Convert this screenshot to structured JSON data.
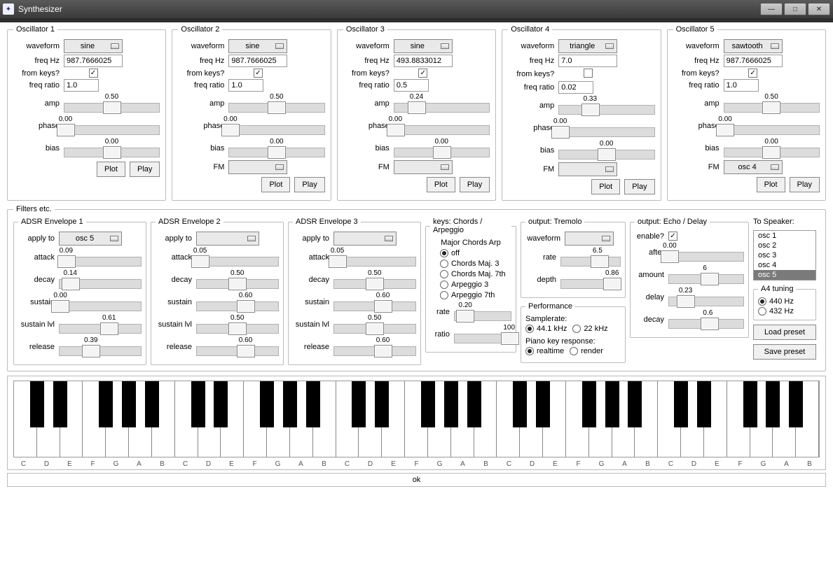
{
  "window": {
    "title": "Synthesizer"
  },
  "labels": {
    "waveform": "waveform",
    "freq": "freq Hz",
    "fromkeys": "from keys?",
    "ratio": "freq ratio",
    "amp": "amp",
    "phase": "phase",
    "bias": "bias",
    "fm": "FM",
    "plot": "Plot",
    "play": "Play",
    "applyto": "apply to",
    "attack": "attack",
    "decay": "decay",
    "sustain": "sustain",
    "sustainlvl": "sustain lvl",
    "release": "release",
    "rate": "rate",
    "ratio2": "ratio",
    "depth": "depth",
    "enable": "enable?",
    "after": "after",
    "amount": "amount",
    "delay": "delay",
    "decay2": "decay",
    "samplerate": "Samplerate:",
    "pianoresp": "Piano key response:",
    "tospeaker": "To Speaker:",
    "loadpreset": "Load preset",
    "savepreset": "Save preset",
    "ok": "ok"
  },
  "oscillators": [
    {
      "title": "Oscillator 1",
      "waveform": "sine",
      "freq": "987.7666025",
      "fromkeys": true,
      "ratio": "1.0",
      "amp": {
        "v": "0.50",
        "p": 0.5
      },
      "phase": {
        "v": "0.00",
        "p": 0.02
      },
      "bias": {
        "v": "0.00",
        "p": 0.5
      },
      "fm": null
    },
    {
      "title": "Oscillator 2",
      "waveform": "sine",
      "freq": "987.7666025",
      "fromkeys": true,
      "ratio": "1.0",
      "amp": {
        "v": "0.50",
        "p": 0.5
      },
      "phase": {
        "v": "0.00",
        "p": 0.02
      },
      "bias": {
        "v": "0.00",
        "p": 0.5
      },
      "fm": "<none>"
    },
    {
      "title": "Oscillator 3",
      "waveform": "sine",
      "freq": "493.8833012",
      "fromkeys": true,
      "ratio": "0.5",
      "amp": {
        "v": "0.24",
        "p": 0.24
      },
      "phase": {
        "v": "0.00",
        "p": 0.02
      },
      "bias": {
        "v": "0.00",
        "p": 0.5
      },
      "fm": "<none>"
    },
    {
      "title": "Oscillator 4",
      "waveform": "triangle",
      "freq": "7.0",
      "fromkeys": false,
      "ratio": "0.02",
      "amp": {
        "v": "0.33",
        "p": 0.33
      },
      "phase": {
        "v": "0.00",
        "p": 0.02
      },
      "bias": {
        "v": "0.00",
        "p": 0.5
      },
      "fm": "<none>"
    },
    {
      "title": "Oscillator 5",
      "waveform": "sawtooth",
      "freq": "987.7666025",
      "fromkeys": true,
      "ratio": "1.0",
      "amp": {
        "v": "0.50",
        "p": 0.5
      },
      "phase": {
        "v": "0.00",
        "p": 0.02
      },
      "bias": {
        "v": "0.00",
        "p": 0.5
      },
      "fm": "osc 4"
    }
  ],
  "filters_title": "Filters etc.",
  "envelopes": [
    {
      "title": "ADSR Envelope 1",
      "applyto": "osc 5",
      "attack": {
        "v": "0.09",
        "p": 0.09
      },
      "decay": {
        "v": "0.14",
        "p": 0.14
      },
      "sustain": {
        "v": "0.00",
        "p": 0.02
      },
      "sustainlvl": {
        "v": "0.61",
        "p": 0.61
      },
      "release": {
        "v": "0.39",
        "p": 0.39
      }
    },
    {
      "title": "ADSR Envelope 2",
      "applyto": "<none>",
      "attack": {
        "v": "0.05",
        "p": 0.05
      },
      "decay": {
        "v": "0.50",
        "p": 0.5
      },
      "sustain": {
        "v": "0.60",
        "p": 0.6
      },
      "sustainlvl": {
        "v": "0.50",
        "p": 0.5
      },
      "release": {
        "v": "0.60",
        "p": 0.6
      }
    },
    {
      "title": "ADSR Envelope 3",
      "applyto": "<none>",
      "attack": {
        "v": "0.05",
        "p": 0.05
      },
      "decay": {
        "v": "0.50",
        "p": 0.5
      },
      "sustain": {
        "v": "0.60",
        "p": 0.6
      },
      "sustainlvl": {
        "v": "0.50",
        "p": 0.5
      },
      "release": {
        "v": "0.60",
        "p": 0.6
      }
    }
  ],
  "keys": {
    "title": "keys: Chords / Arpeggio",
    "subtitle": "Major Chords Arp",
    "options": [
      "off",
      "Chords Maj. 3",
      "Chords Maj. 7th",
      "Arpeggio 3",
      "Arpeggio 7th"
    ],
    "selected": 0,
    "rate": {
      "v": "0.20",
      "p": 0.2
    },
    "ratio": {
      "v": "100",
      "p": 0.98
    }
  },
  "tremolo": {
    "title": "output: Tremolo",
    "waveform": "<off>",
    "rate": {
      "v": "6.5",
      "p": 0.65
    },
    "depth": {
      "v": "0.86",
      "p": 0.86
    }
  },
  "performance": {
    "title": "Performance",
    "sr_options": [
      "44.1 kHz",
      "22 kHz"
    ],
    "sr_sel": 0,
    "resp_options": [
      "realtime",
      "render"
    ],
    "resp_sel": 0
  },
  "echo": {
    "title": "output: Echo / Delay",
    "enabled": true,
    "after": {
      "v": "0.00",
      "p": 0.02
    },
    "amount": {
      "v": "6",
      "p": 0.55
    },
    "delay": {
      "v": "0.23",
      "p": 0.23
    },
    "decay": {
      "v": "0.6",
      "p": 0.55
    }
  },
  "speaker": {
    "items": [
      "osc 1",
      "osc 2",
      "osc 3",
      "osc 4",
      "osc 5"
    ],
    "selected": 4
  },
  "a4": {
    "title": "A4 tuning",
    "options": [
      "440 Hz",
      "432 Hz"
    ],
    "selected": 0
  },
  "whitekeys_per_oct": [
    "C",
    "D",
    "E",
    "F",
    "G",
    "A",
    "B"
  ],
  "octaves": 5
}
